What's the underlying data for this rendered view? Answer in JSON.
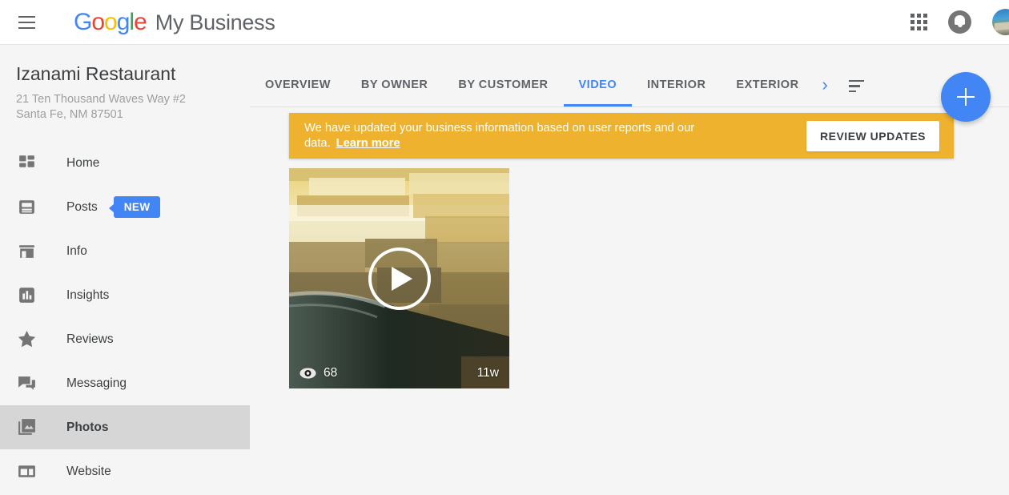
{
  "topbar": {
    "menu_icon": "hamburger-icon",
    "logo_letters": [
      "G",
      "o",
      "o",
      "g",
      "l",
      "e"
    ],
    "brand_word": "My Business",
    "apps_icon": "apps-grid-icon",
    "notifications_icon": "bell-icon",
    "avatar_icon": "user-avatar"
  },
  "sidebar": {
    "business_name": "Izanami Restaurant",
    "address_line1": "21 Ten Thousand Waves Way #2",
    "address_line2": "Santa Fe, NM 87501",
    "items": [
      {
        "label": "Home",
        "icon": "dashboard-icon",
        "active": false,
        "badge": ""
      },
      {
        "label": "Posts",
        "icon": "posts-icon",
        "active": false,
        "badge": "NEW"
      },
      {
        "label": "Info",
        "icon": "storefront-icon",
        "active": false,
        "badge": ""
      },
      {
        "label": "Insights",
        "icon": "bar-chart-icon",
        "active": false,
        "badge": ""
      },
      {
        "label": "Reviews",
        "icon": "star-icon",
        "active": false,
        "badge": ""
      },
      {
        "label": "Messaging",
        "icon": "chat-icon",
        "active": false,
        "badge": ""
      },
      {
        "label": "Photos",
        "icon": "photos-icon",
        "active": true,
        "badge": ""
      },
      {
        "label": "Website",
        "icon": "website-icon",
        "active": false,
        "badge": ""
      }
    ]
  },
  "main": {
    "tabs": [
      {
        "label": "OVERVIEW",
        "active": false
      },
      {
        "label": "BY OWNER",
        "active": false
      },
      {
        "label": "BY CUSTOMER",
        "active": false
      },
      {
        "label": "VIDEO",
        "active": true
      },
      {
        "label": "INTERIOR",
        "active": false
      },
      {
        "label": "EXTERIOR",
        "active": false
      }
    ],
    "next_arrow": "›",
    "sort_icon": "sort-icon",
    "add_button_icon": "plus-icon"
  },
  "banner": {
    "message": "We have updated your business information based on user reports and our data.",
    "link_label": "Learn more",
    "button_label": "REVIEW UPDATES",
    "color": "#efb22f"
  },
  "photos": [
    {
      "type": "video",
      "views": "68",
      "views_icon": "eye-icon",
      "age": "11w",
      "play_icon": "play-icon",
      "description": "Sunlit stone wall with water"
    }
  ],
  "colors": {
    "accent_blue": "#4285f4",
    "banner_orange": "#efb22f",
    "active_nav_gray": "#d6d6d6",
    "page_bg": "#f5f5f5"
  }
}
